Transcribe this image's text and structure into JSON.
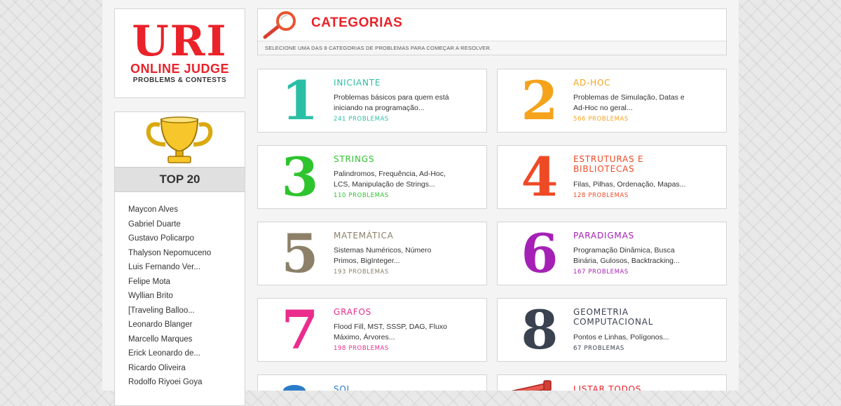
{
  "logo": {
    "main": "URI",
    "line1": "ONLINE JUDGE",
    "line2": "PROBLEMS & CONTESTS"
  },
  "header": {
    "title": "CATEGORIAS",
    "subtitle": "SELECIONE UMA DAS 8 CATEGORIAS DE PROBLEMAS PARA COMEÇAR A RESOLVER."
  },
  "top20": {
    "title": "TOP 20",
    "users": [
      "Maycon Alves",
      "Gabriel Duarte",
      "Gustavo Policarpo",
      "Thalyson Nepomuceno",
      "Luis Fernando Ver...",
      "Felipe Mota",
      "Wyllian Brito",
      "[Traveling Balloo...",
      "Leonardo Blanger",
      "Marcello Marques",
      "Erick Leonardo de...",
      "Ricardo Oliveira",
      "Rodolfo Riyoei Goya"
    ]
  },
  "categories": [
    {
      "number": "1",
      "title": "INICIANTE",
      "desc1": "Problemas básicos para quem está",
      "desc2": "iniciando na programação...",
      "count": "241 PROBLEMAS",
      "color": "#2bbfa5"
    },
    {
      "number": "2",
      "title": "AD-HOC",
      "desc1": "Problemas de Simulação, Datas e",
      "desc2": "Ad-Hoc no geral...",
      "count": "566 PROBLEMAS",
      "color": "#f5a31b"
    },
    {
      "number": "3",
      "title": "STRINGS",
      "desc1": "Palindromos, Frequência, Ad-Hoc,",
      "desc2": "LCS, Manipulação de Strings...",
      "count": "110 PROBLEMAS",
      "color": "#2ec42e"
    },
    {
      "number": "4",
      "title1": "ESTRUTURAS E",
      "title2": "BIBLIOTECAS",
      "desc1": "Filas, Pilhas, Ordenação, Mapas...",
      "desc2": "",
      "count": "128 PROBLEMAS",
      "color": "#ef4a26"
    },
    {
      "number": "5",
      "title": "MATEMÁTICA",
      "desc1": "Sistemas Numéricos, Número",
      "desc2": "Primos, BigInteger...",
      "count": "193 PROBLEMAS",
      "color": "#8c8068"
    },
    {
      "number": "6",
      "title": "PARADIGMAS",
      "desc1": "Programação Dinâmica, Busca",
      "desc2": "Binária, Gulosos, Backtracking...",
      "count": "167 PROBLEMAS",
      "color": "#a521b5"
    },
    {
      "number": "7",
      "title": "GRAFOS",
      "desc1": "Flood Fill, MST, SSSP, DAG, Fluxo",
      "desc2": "Máximo, Árvores...",
      "count": "198 PROBLEMAS",
      "color": "#ea2d8d"
    },
    {
      "number": "8",
      "title1": "GEOMETRIA",
      "title2": "COMPUTACIONAL",
      "desc1": "Pontos e Linhas, Polígonos...",
      "desc2": "",
      "count": "67 PROBLEMAS",
      "color": "#3a4250"
    }
  ],
  "partial": [
    {
      "title": "SQL",
      "color": "#2a7dc9"
    },
    {
      "title": "LISTAR TODOS",
      "color": "#ea2229"
    }
  ]
}
